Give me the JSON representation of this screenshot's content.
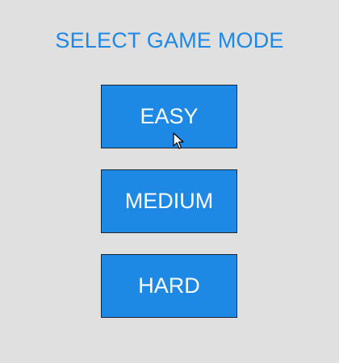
{
  "screen": {
    "title": "SELECT GAME MODE",
    "background_color": "#e0e0e0",
    "accent_color": "#1e88e5"
  },
  "modes": [
    {
      "label": "EASY"
    },
    {
      "label": "MEDIUM"
    },
    {
      "label": "HARD"
    }
  ],
  "pointer": {
    "icon": "arrow-cursor-icon",
    "hovering": "EASY"
  }
}
